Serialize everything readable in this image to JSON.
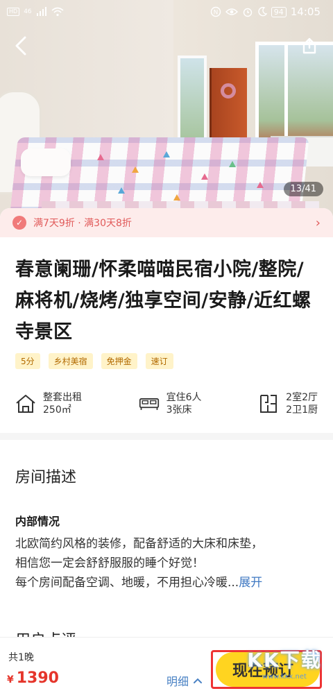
{
  "statusbar": {
    "left_chip": "HD",
    "net": "46",
    "battery": "94",
    "time": "14:05"
  },
  "hero": {
    "counter": "13/41"
  },
  "promo": {
    "text": "满7天9折 · 满30天8折"
  },
  "listing": {
    "title": "春意阑珊/怀柔喵喵民宿小院/整院/麻将机/烧烤/独享空间/安静/近红螺寺景区",
    "tags": [
      "5分",
      "乡村美宿",
      "免押金",
      "速订"
    ]
  },
  "features": [
    {
      "icon": "house-icon",
      "line1": "整套出租",
      "line2": "250㎡"
    },
    {
      "icon": "bed-icon",
      "line1": "宜住6人",
      "line2": "3张床"
    },
    {
      "icon": "floorplan-icon",
      "line1": "2室2厅",
      "line2": "2卫1厨"
    }
  ],
  "description": {
    "section_title": "房间描述",
    "subtitle": "内部情况",
    "line1": "北欧简约风格的装修，配备舒适的大床和床垫，",
    "line2": "相信您一定会舒舒服服的睡个好觉！",
    "line3": "每个房间配备空调、地暖，不用担心冷暖...",
    "more": "展开"
  },
  "reviews": {
    "title": "用户点评"
  },
  "bottom": {
    "nights": "共1晚",
    "currency": "¥",
    "price": "1390",
    "detail": "明细",
    "book": "现在预订"
  },
  "watermark": {
    "logo": "KK下载",
    "url": "www.kkx.net"
  },
  "colors": {
    "accent": "#ffd420",
    "price": "#e5352b",
    "link": "#3f78c2",
    "promo_bg": "#fdeceb"
  }
}
